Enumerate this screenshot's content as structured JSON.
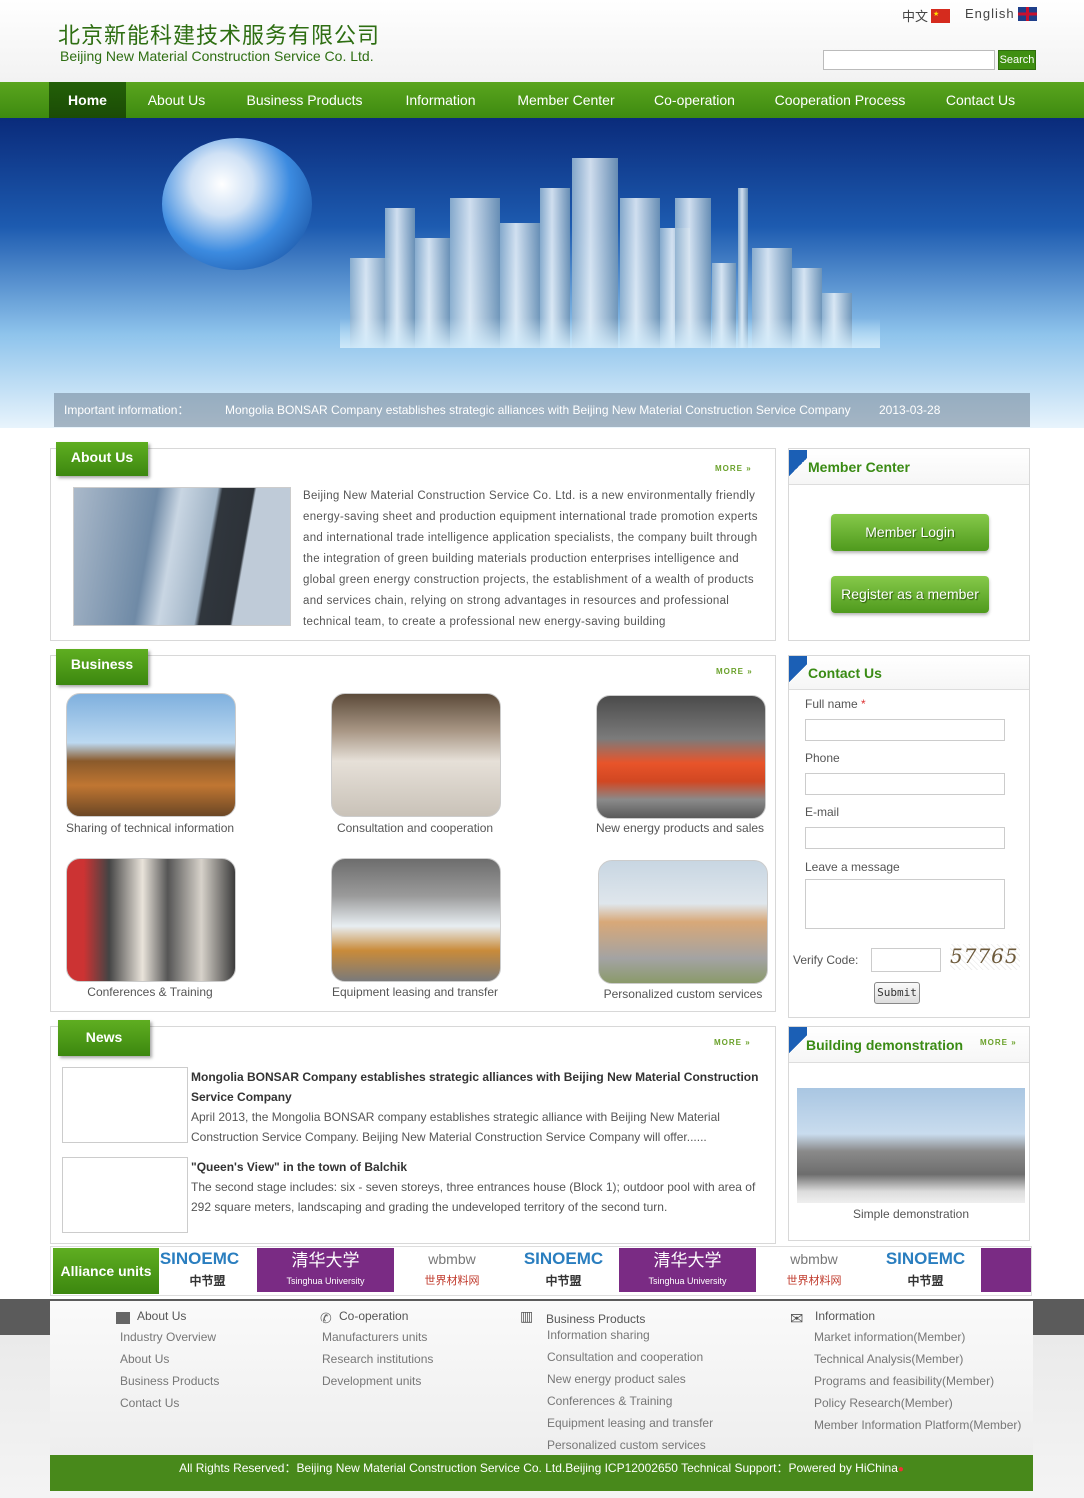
{
  "header": {
    "logo_cn": "北京新能科建技术服务有限公司",
    "logo_en": "Beijing New Material Construction Service Co. Ltd.",
    "lang_cn": "中文",
    "lang_en": "English",
    "search_placeholder": "",
    "search_label": "Search"
  },
  "nav": [
    "Home",
    "About Us",
    "Business Products",
    "Information",
    "Member Center",
    "Co-operation",
    "Cooperation Process",
    "Contact Us"
  ],
  "ticker": {
    "label": "Important information：",
    "text": "Mongolia BONSAR Company establishes strategic alliances with Beijing New Material Construction Service Company",
    "date": "2013-03-28"
  },
  "about": {
    "title": "About Us",
    "more": "MORE »",
    "text": "Beijing New Material Construction Service Co. Ltd. is a new environmentally friendly energy-saving sheet and production equipment international trade promotion experts and international trade intelligence application specialists, the company built through the integration of green building materials production enterprises intelligence and global green energy construction projects, the establishment of a wealth of products and services chain, relying on strong advantages in resources and professional technical team, to create a professional new energy-saving building"
  },
  "business": {
    "title": "Business",
    "more": "MORE »",
    "items": [
      "Sharing of technical information",
      "Consultation and cooperation",
      "New energy products and sales",
      "Conferences & Training",
      "Equipment leasing and transfer",
      "Personalized custom services"
    ]
  },
  "news": {
    "title": "News",
    "more": "MORE »",
    "items": [
      {
        "title": "Mongolia BONSAR Company establishes strategic alliances with Beijing New Material Construction Service Company",
        "body": "April 2013, the Mongolia BONSAR company establishes strategic alliance with Beijing New Material Construction Service Company. Beijing New Material Construction Service Company will offer......"
      },
      {
        "title": "\"Queen's View\" in the town of Balchik",
        "body": "The second stage includes: six - seven storeys, three entrances house (Block 1); outdoor pool with area of 292 square meters, landscaping and grading the undeveloped territory of the second turn."
      }
    ]
  },
  "member": {
    "title": "Member Center",
    "login": "Member Login",
    "register": "Register as a member"
  },
  "contact": {
    "title": "Contact Us",
    "full_name": "Full name",
    "required": "*",
    "phone": "Phone",
    "email": "E-mail",
    "message": "Leave a message",
    "verify": "Verify Code:",
    "captcha": "57765",
    "submit": "Submit"
  },
  "building": {
    "title": "Building demonstration",
    "more": "MORE »",
    "caption": "Simple demonstration"
  },
  "alliance": {
    "label": "Alliance units",
    "logos": [
      {
        "main": "SINOEMC",
        "sub": "中节盟"
      },
      {
        "main": "清华大学",
        "sub": "Tsinghua University"
      },
      {
        "main": "wbmbw",
        "sub": "世界材料网"
      }
    ]
  },
  "footer": {
    "cols": [
      {
        "head": "About Us",
        "items": [
          "Industry Overview",
          "About Us",
          "Business Products",
          "Contact Us"
        ]
      },
      {
        "head": "Co-operation",
        "items": [
          "Manufacturers units",
          "Research institutions",
          "Development units"
        ]
      },
      {
        "head": "Business Products",
        "items": [
          "Information sharing",
          "Consultation and cooperation",
          "New energy product sales",
          "Conferences & Training",
          "Equipment leasing and transfer",
          "Personalized custom services"
        ]
      },
      {
        "head": "Information",
        "items": [
          "Market information(Member)",
          "Technical Analysis(Member)",
          "Programs and feasibility(Member)",
          "Policy Research(Member)",
          "Member Information Platform(Member)"
        ]
      }
    ],
    "copyright": "All Rights Reserved：Beijing New Material Construction Service Co. Ltd.Beijing ICP12002650 Technical Support：Powered by HiChina"
  },
  "colors": {
    "brand_green": "#3e8a10",
    "banner_blue": "#0a2b7b"
  }
}
